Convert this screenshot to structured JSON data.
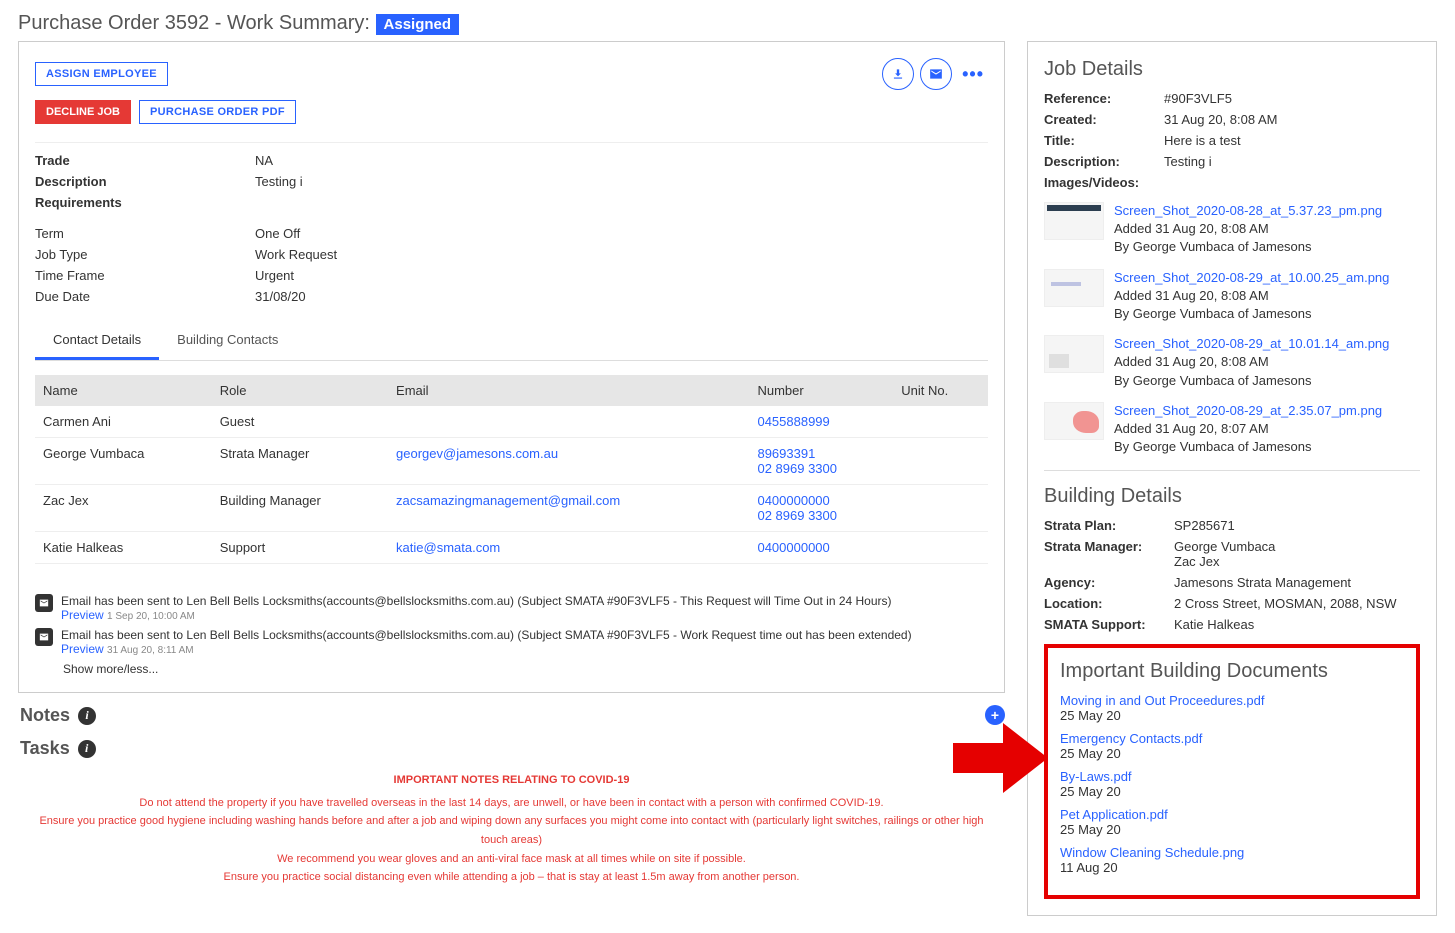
{
  "header": {
    "title_prefix": "Purchase Order 3592 - Work Summary: ",
    "status": "Assigned"
  },
  "actions": {
    "assign_employee": "ASSIGN EMPLOYEE",
    "decline_job": "DECLINE JOB",
    "purchase_order_pdf": "PURCHASE ORDER PDF"
  },
  "details1": {
    "trade_label": "Trade",
    "trade": "NA",
    "description_label": "Description",
    "description": "Testing i",
    "requirements_label": "Requirements",
    "requirements": ""
  },
  "details2": {
    "term_label": "Term",
    "term": "One Off",
    "job_type_label": "Job Type",
    "job_type": "Work Request",
    "time_frame_label": "Time Frame",
    "time_frame": "Urgent",
    "due_date_label": "Due Date",
    "due_date": "31/08/20"
  },
  "tabs": {
    "contact_details": "Contact Details",
    "building_contacts": "Building Contacts"
  },
  "table": {
    "headers": {
      "name": "Name",
      "role": "Role",
      "email": "Email",
      "number": "Number",
      "unit": "Unit No."
    },
    "rows": [
      {
        "name": "Carmen Ani",
        "role": "Guest",
        "email": "",
        "numbers": [
          "0455888999"
        ],
        "unit": ""
      },
      {
        "name": "George Vumbaca",
        "role": "Strata Manager",
        "email": "georgev@jamesons.com.au",
        "numbers": [
          "89693391",
          "02 8969 3300"
        ],
        "unit": ""
      },
      {
        "name": "Zac Jex",
        "role": "Building Manager",
        "email": "zacsamazingmanagement@gmail.com",
        "numbers": [
          "0400000000",
          "02 8969 3300"
        ],
        "unit": ""
      },
      {
        "name": "Katie Halkeas",
        "role": "Support",
        "email": "katie@smata.com",
        "numbers": [
          "0400000000"
        ],
        "unit": ""
      }
    ]
  },
  "logs": {
    "items": [
      {
        "text": "Email has been sent to Len Bell Bells Locksmiths(accounts@bellslocksmiths.com.au) (Subject SMATA #90F3VLF5 - This Request will Time Out in 24 Hours)",
        "preview": "Preview",
        "time": "1 Sep 20, 10:00 AM"
      },
      {
        "text": "Email has been sent to Len Bell Bells Locksmiths(accounts@bellslocksmiths.com.au) (Subject SMATA #90F3VLF5 - Work Request time out has been extended)",
        "preview": "Preview",
        "time": "31 Aug 20, 8:11 AM"
      }
    ],
    "show_more": "Show more/less..."
  },
  "notes_label": "Notes",
  "tasks_label": "Tasks",
  "covid": {
    "head": "IMPORTANT NOTES RELATING TO COVID-19",
    "l1": "Do not attend the property if you have travelled overseas in the last 14 days, are unwell, or have been in contact with a person with confirmed COVID-19.",
    "l2": "Ensure you practice good hygiene including washing hands before and after a job and wiping down any surfaces you might come into contact with (particularly light switches, railings or other high touch areas)",
    "l3": "We recommend you wear gloves and an anti-viral face mask at all times while on site if possible.",
    "l4": "Ensure you practice social distancing even while attending a job – that is stay at least 1.5m away from another person."
  },
  "job_details": {
    "title": "Job Details",
    "reference_label": "Reference:",
    "reference": "#90F3VLF5",
    "created_label": "Created:",
    "created": "31 Aug 20, 8:08 AM",
    "title_label": "Title:",
    "title_val": "Here is a test",
    "description_label": "Description:",
    "description": "Testing i",
    "images_label": "Images/Videos:",
    "attachments": [
      {
        "fname": "Screen_Shot_2020-08-28_at_5.37.23_pm.png",
        "added": "Added 31 Aug 20, 8:08 AM",
        "by": "By George Vumbaca of Jamesons"
      },
      {
        "fname": "Screen_Shot_2020-08-29_at_10.00.25_am.png",
        "added": "Added 31 Aug 20, 8:08 AM",
        "by": "By George Vumbaca of Jamesons"
      },
      {
        "fname": "Screen_Shot_2020-08-29_at_10.01.14_am.png",
        "added": "Added 31 Aug 20, 8:08 AM",
        "by": "By George Vumbaca of Jamesons"
      },
      {
        "fname": "Screen_Shot_2020-08-29_at_2.35.07_pm.png",
        "added": "Added 31 Aug 20, 8:07 AM",
        "by": "By George Vumbaca of Jamesons"
      }
    ]
  },
  "building_details": {
    "title": "Building Details",
    "strata_plan_label": "Strata Plan:",
    "strata_plan": "SP285671",
    "strata_manager_label": "Strata Manager:",
    "strata_manager1": "George Vumbaca",
    "strata_manager2": "Zac Jex",
    "agency_label": "Agency:",
    "agency": "Jamesons Strata Management",
    "location_label": "Location:",
    "location": "2 Cross Street, MOSMAN, 2088, NSW",
    "support_label": "SMATA Support:",
    "support": "Katie Halkeas"
  },
  "important_docs": {
    "title": "Important Building Documents",
    "items": [
      {
        "name": "Moving in and Out Proceedures.pdf",
        "date": "25 May 20"
      },
      {
        "name": "Emergency Contacts.pdf",
        "date": "25 May 20"
      },
      {
        "name": "By-Laws.pdf",
        "date": "25 May 20"
      },
      {
        "name": "Pet Application.pdf",
        "date": "25 May 20"
      },
      {
        "name": "Window Cleaning Schedule.png",
        "date": "11 Aug 20"
      }
    ]
  }
}
